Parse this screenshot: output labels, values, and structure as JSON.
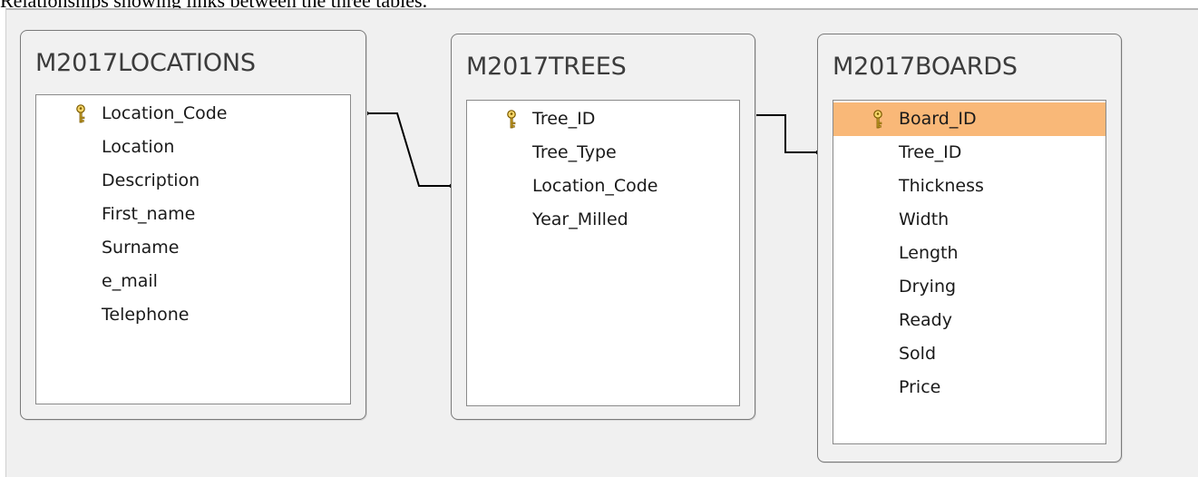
{
  "caption": "Relationships showing links between the three tables.",
  "tables": [
    {
      "name": "M2017LOCATIONS",
      "fields": [
        "Location_Code",
        "Location",
        "Description",
        "First_name",
        "Surname",
        "e_mail",
        "Telephone"
      ],
      "primary_key": "Location_Code"
    },
    {
      "name": "M2017TREES",
      "fields": [
        "Tree_ID",
        "Tree_Type",
        "Location_Code",
        "Year_Milled"
      ],
      "primary_key": "Tree_ID"
    },
    {
      "name": "M2017BOARDS",
      "fields": [
        "Board_ID",
        "Tree_ID",
        "Thickness",
        "Width",
        "Length",
        "Drying",
        "Ready",
        "Sold",
        "Price"
      ],
      "primary_key": "Board_ID",
      "selected_field": "Board_ID"
    }
  ],
  "relationships": [
    {
      "from_table": "M2017LOCATIONS",
      "from_field": "Location_Code",
      "to_table": "M2017TREES",
      "to_field": "Location_Code"
    },
    {
      "from_table": "M2017TREES",
      "from_field": "Tree_ID",
      "to_table": "M2017BOARDS",
      "to_field": "Tree_ID"
    }
  ],
  "colors": {
    "selected_field": "#f9b878",
    "key_icon": "#d4a62a",
    "line": "#000000"
  },
  "icons": {
    "primary_key": "key-icon"
  }
}
